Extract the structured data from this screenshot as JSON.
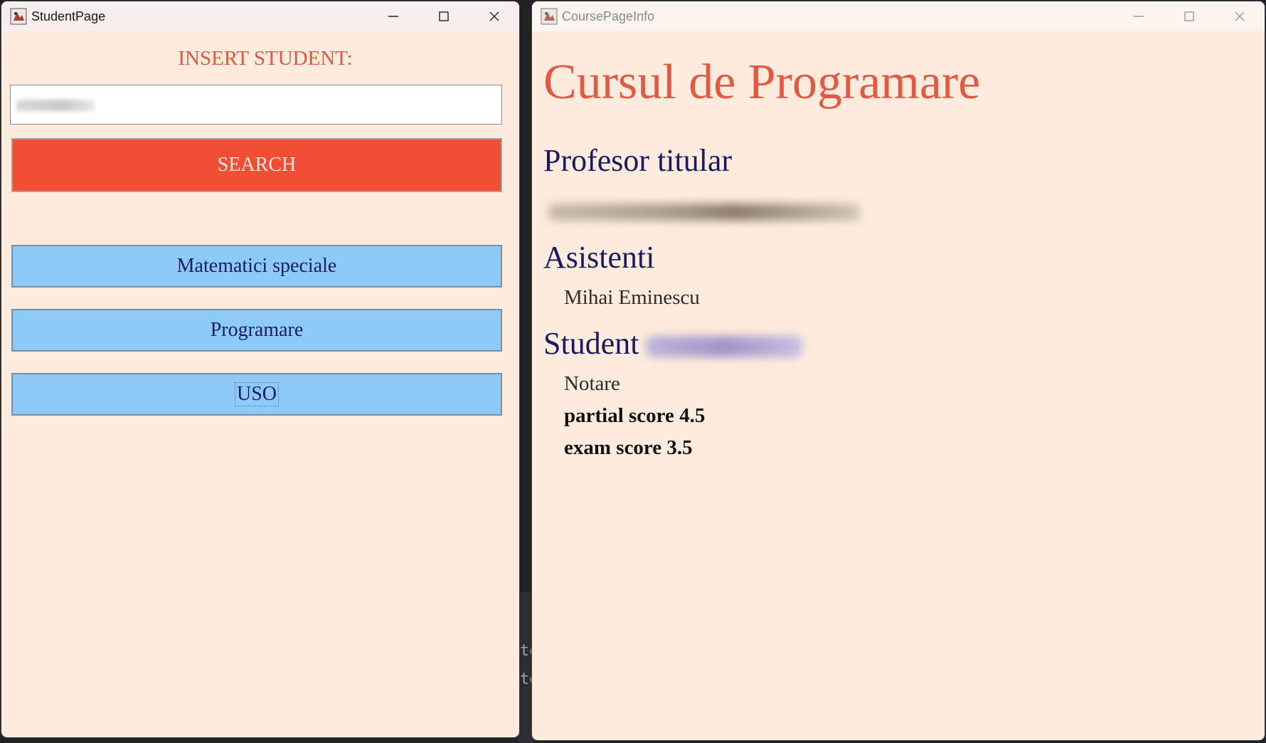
{
  "student_window": {
    "title": "StudentPage",
    "insert_label": "INSERT STUDENT:",
    "search_value": "",
    "search_button": "SEARCH",
    "courses": [
      {
        "label": "Matematici speciale"
      },
      {
        "label": "Programare"
      },
      {
        "label": "USO"
      }
    ]
  },
  "course_window": {
    "title": "CoursePageInfo",
    "course_title": "Cursul de Programare",
    "prof_heading": "Profesor titular",
    "assistants_heading": "Asistenti",
    "assistants": [
      "Mihai Eminescu"
    ],
    "student_heading": "Student",
    "grades_label": "Notare",
    "partial_score": "partial score 4.5",
    "exam_score": "exam score 3.5"
  },
  "background_terminal": {
    "lines": [
      "te",
      "te"
    ]
  },
  "colors": {
    "window_bg": "#fdecdd",
    "search_button_bg": "#f04f33",
    "course_button_bg": "#8ccbf8",
    "title_red": "#e35a44",
    "heading_navy": "#1c1a5f"
  }
}
